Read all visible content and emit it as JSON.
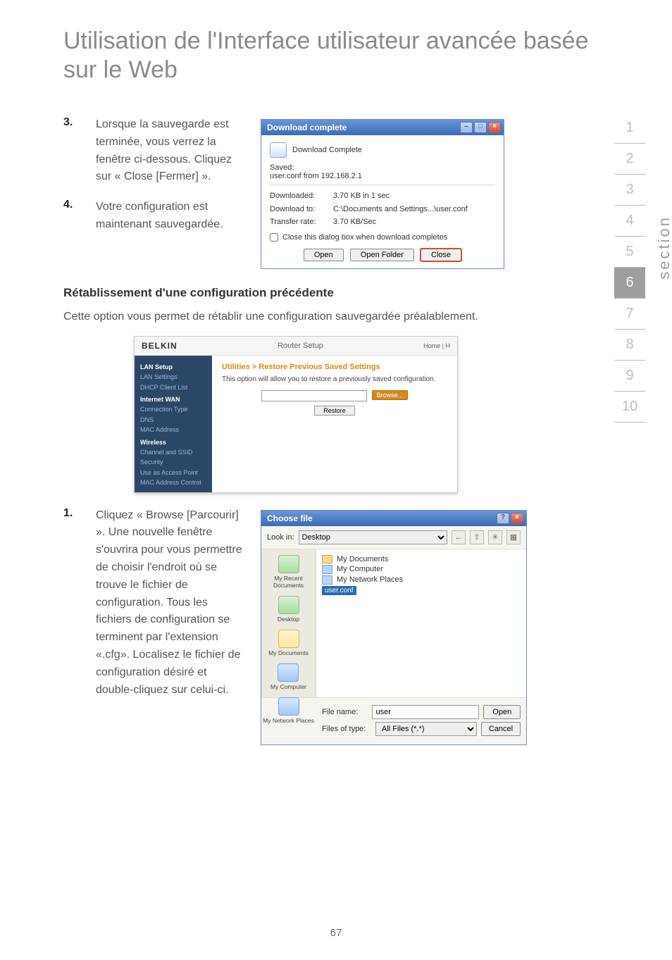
{
  "page": {
    "title": "Utilisation de l'Interface utilisateur avancée basée sur le Web",
    "number": "67"
  },
  "rail": {
    "label": "section",
    "items": [
      "1",
      "2",
      "3",
      "4",
      "5",
      "6",
      "7",
      "8",
      "9",
      "10"
    ],
    "active": "6"
  },
  "steps": {
    "s3_num": "3.",
    "s3_text": "Lorsque la sauvegarde est terminée, vous verrez la fenêtre ci-dessous. Cliquez sur « Close [Fermer] ».",
    "s4_num": "4.",
    "s4_text": "Votre configuration est maintenant sauvegardée.",
    "s1_num": "1.",
    "s1_text": "Cliquez « Browse [Parcourir] ». Une nouvelle fenêtre s'ouvrira pour vous permettre de choisir l'endroit où se trouve le fichier de configuration. Tous les fichiers de configuration se terminent par l'extension «.cfg». Localisez le fichier de configuration désiré et double-cliquez sur celui-ci."
  },
  "subhead": "Rétablissement d'une configuration précédente",
  "para": "Cette option vous permet de rétablir une configuration sauvegardée préalablement.",
  "dlg": {
    "title": "Download complete",
    "header_text": "Download Complete",
    "saved_label": "Saved:",
    "saved_value": "user.conf from 192.168.2.1",
    "k_downloaded": "Downloaded:",
    "v_downloaded": "3.70 KB in 1 sec",
    "k_to": "Download to:",
    "v_to": "C:\\Documents and Settings...\\user.conf",
    "k_rate": "Transfer rate:",
    "v_rate": "3.70 KB/Sec",
    "check_label": "Close this dialog box when download completes",
    "btn_open": "Open",
    "btn_open_folder": "Open Folder",
    "btn_close": "Close"
  },
  "router": {
    "brand": "BELKIN",
    "title": "Router Setup",
    "home": "Home | H",
    "side": {
      "g1": "LAN Setup",
      "i1a": "LAN Settings",
      "i1b": "DHCP Client List",
      "g2": "Internet WAN",
      "i2a": "Connection Type",
      "i2b": "DNS",
      "i2c": "MAC Address",
      "g3": "Wireless",
      "i3a": "Channel and SSID",
      "i3b": "Security",
      "i3c": "Use as Access Point",
      "i3d": "MAC Address Control"
    },
    "crumb": "Utilities > Restore Previous Saved Settings",
    "desc": "This option will allow you to restore a previously saved configuration.",
    "browse": "Browse...",
    "restore": "Restore"
  },
  "choose": {
    "title": "Choose file",
    "lookin_label": "Look in:",
    "lookin_value": "Desktop",
    "side": {
      "recent": "My Recent Documents",
      "desktop": "Desktop",
      "mydocs": "My Documents",
      "mycomp": "My Computer",
      "mynet": "My Network Places"
    },
    "files": {
      "mydocs": "My Documents",
      "mycomp": "My Computer",
      "mynet": "My Network Places",
      "userconf": "user.conf"
    },
    "filename_label": "File name:",
    "filename_value": "user",
    "type_label": "Files of type:",
    "type_value": "All Files (*.*)",
    "btn_open": "Open",
    "btn_cancel": "Cancel"
  }
}
